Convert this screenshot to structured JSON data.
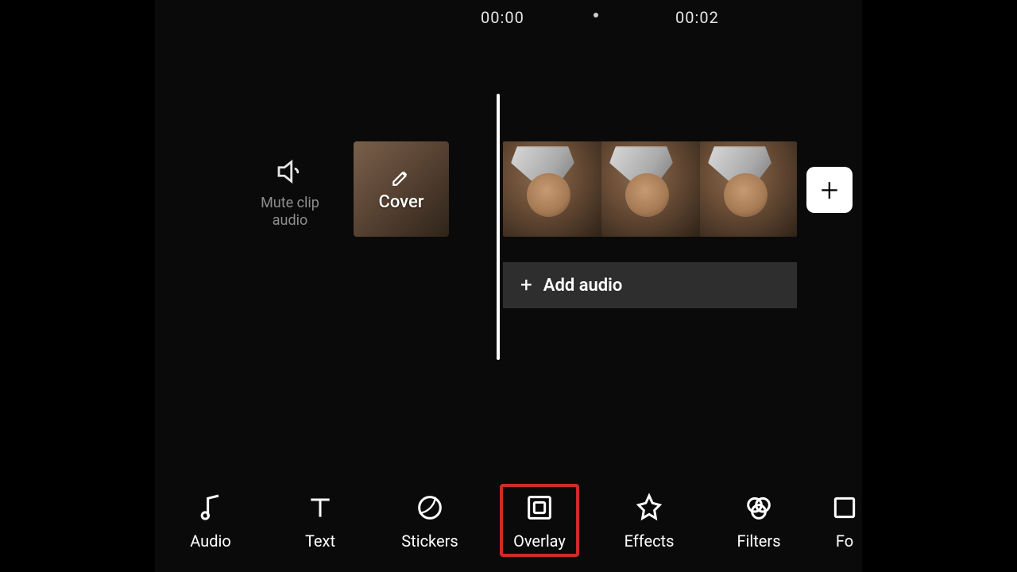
{
  "timeline": {
    "ruler": {
      "start": "00:00",
      "end": "00:02"
    },
    "mute": {
      "label_line1": "Mute clip",
      "label_line2": "audio"
    },
    "cover": {
      "label": "Cover"
    },
    "add_audio": {
      "label": "Add audio",
      "plus": "+"
    },
    "add_clip": {
      "plus": "+"
    }
  },
  "toolbar": {
    "audio": "Audio",
    "text": "Text",
    "stickers": "Stickers",
    "overlay": "Overlay",
    "effects": "Effects",
    "filters": "Filters",
    "format_partial": "Fo"
  }
}
